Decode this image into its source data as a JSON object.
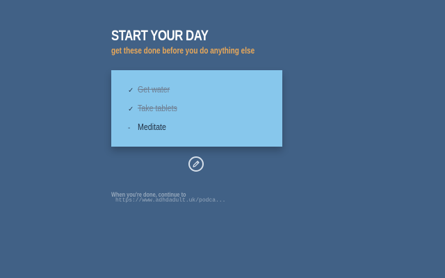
{
  "header": {
    "title": "START YOUR DAY",
    "subtitle": "get these done before you do anything else"
  },
  "tasks": [
    {
      "mark": "✓",
      "label": "Get water",
      "done": true
    },
    {
      "mark": "✓",
      "label": "Take tablets",
      "done": true
    },
    {
      "mark": "-",
      "label": "Meditate",
      "done": false
    }
  ],
  "edit_button": {
    "icon": "pencil-icon"
  },
  "footer": {
    "note": "When you're done, continue to",
    "link": "https://www.adhdadult.uk/podca..."
  },
  "colors": {
    "background": "#416186",
    "card": "#87c7ec",
    "accent": "#e8a85a",
    "title": "#ffffff"
  }
}
